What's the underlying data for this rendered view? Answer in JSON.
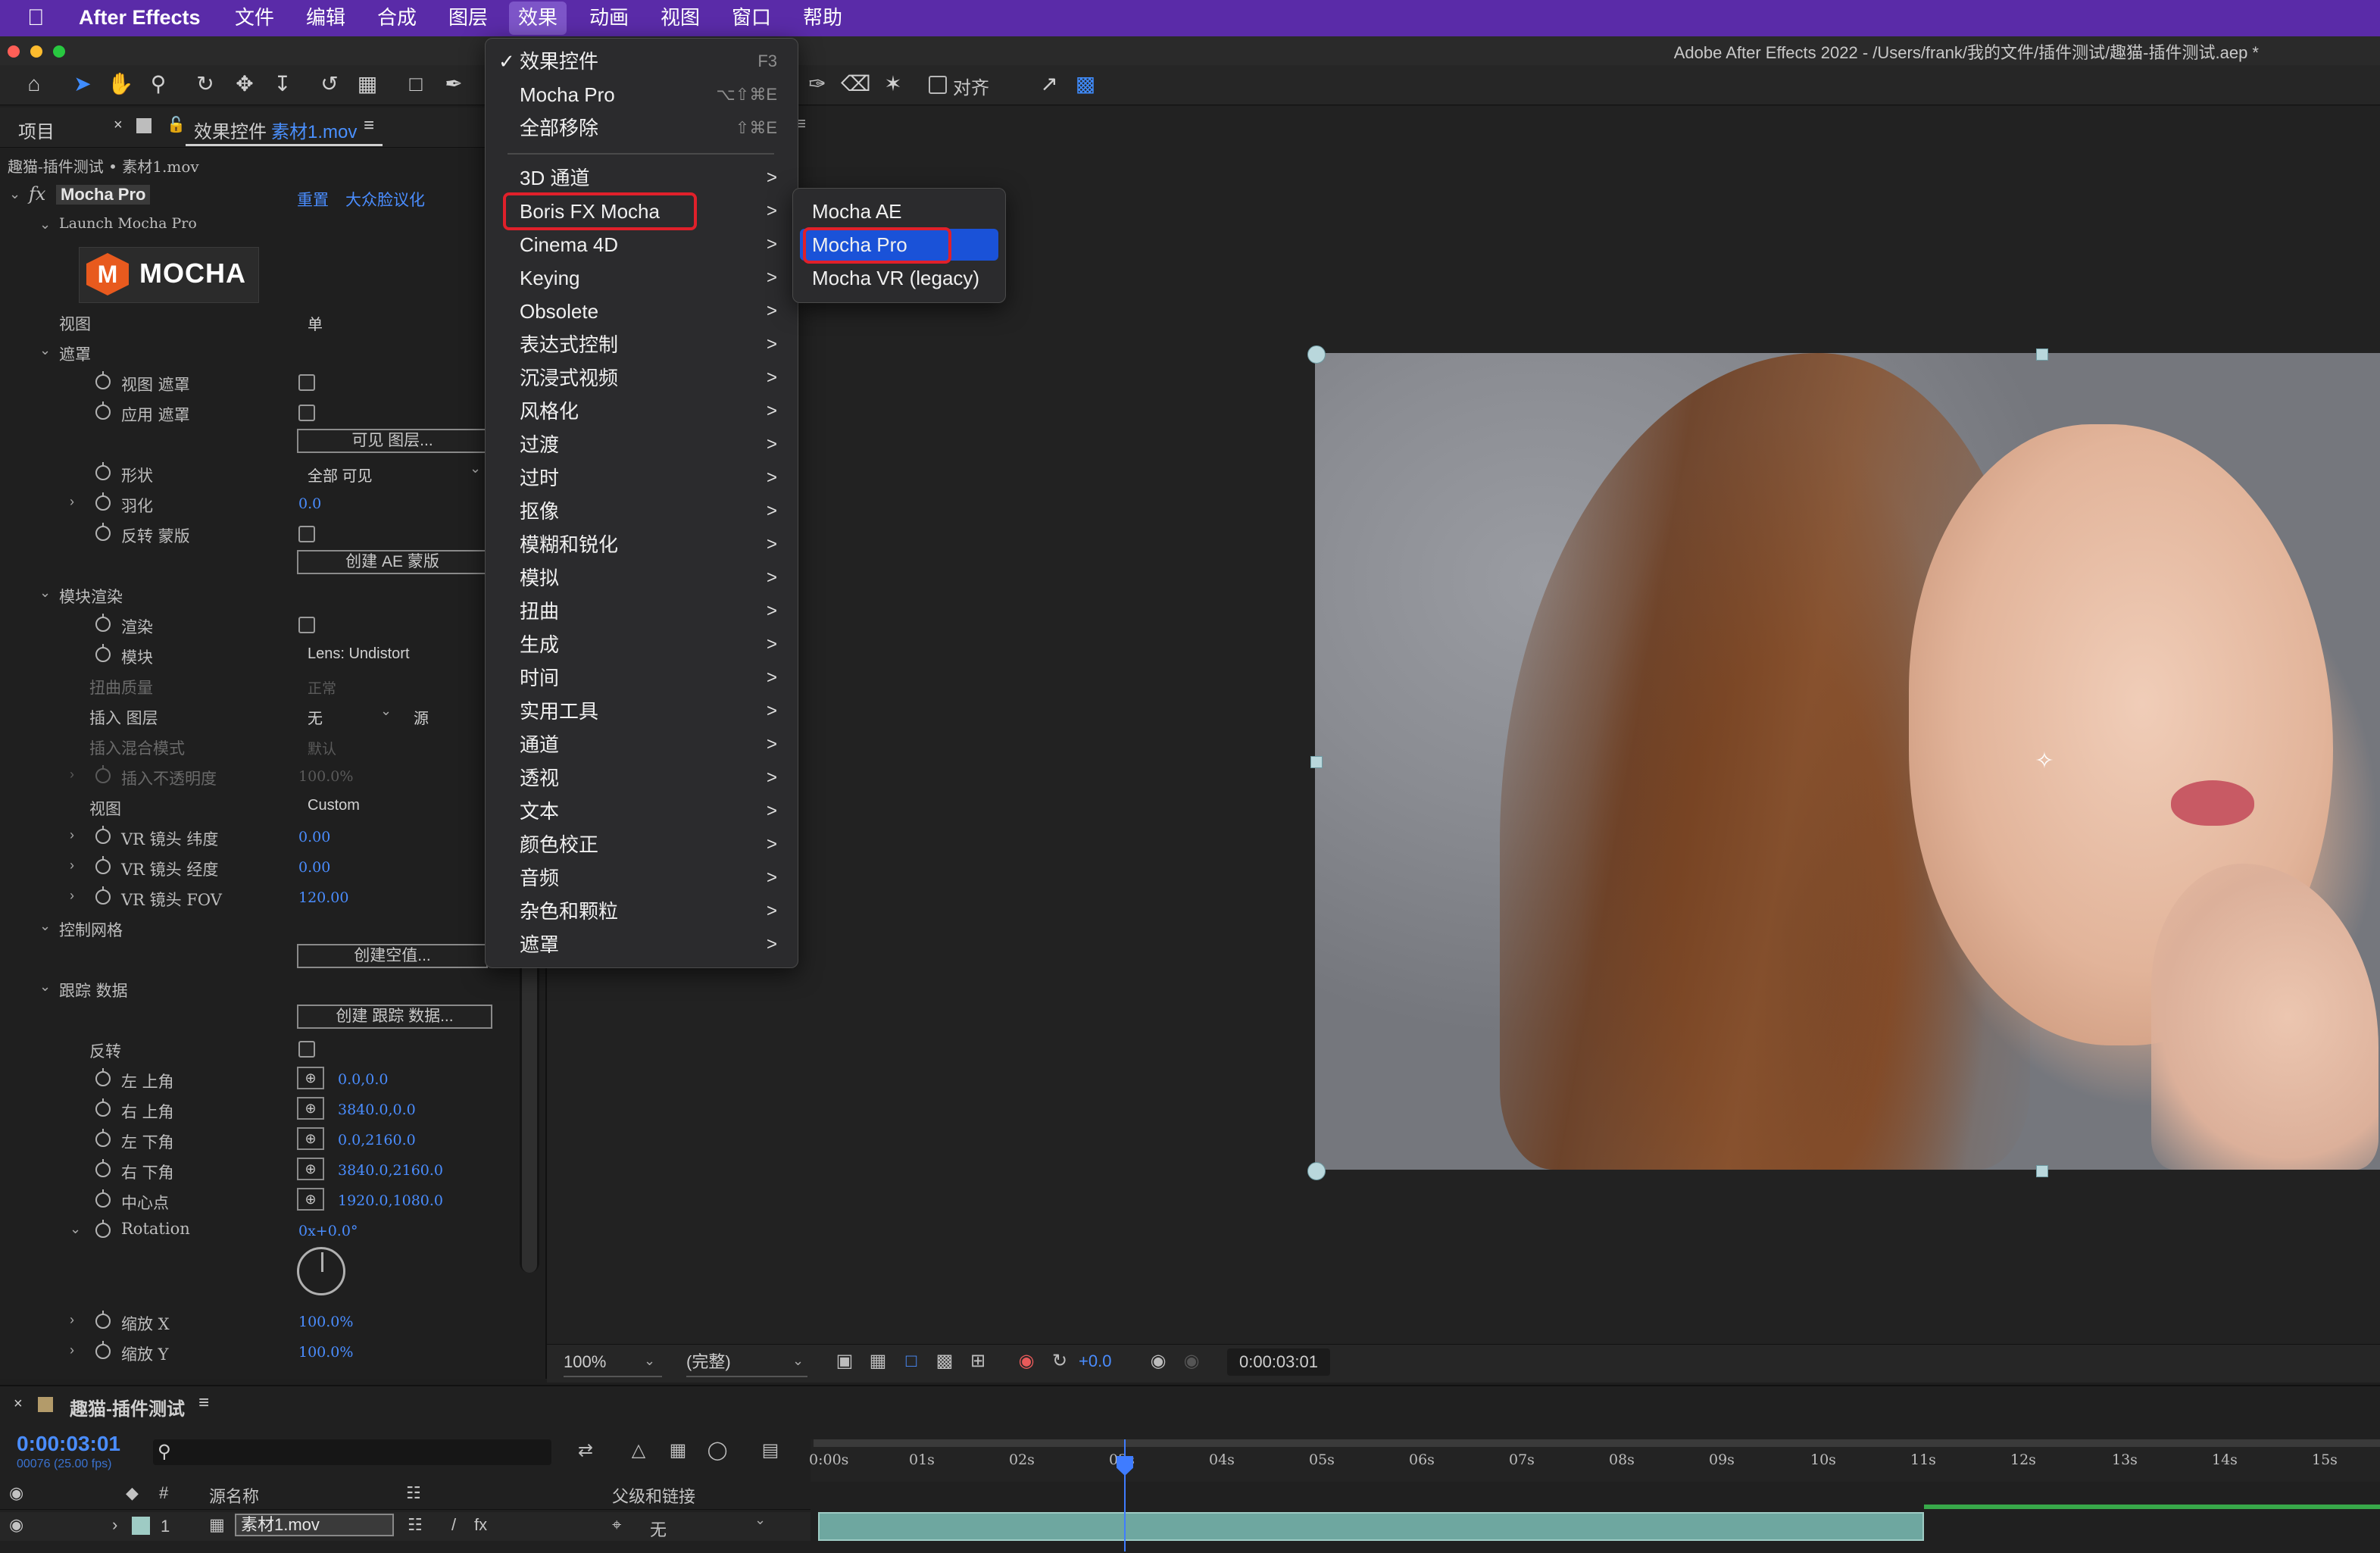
{
  "menubar": {
    "app_name": "After Effects",
    "items": [
      "文件",
      "编辑",
      "合成",
      "图层",
      "效果",
      "动画",
      "视图",
      "窗口",
      "帮助"
    ],
    "active_item": "效果"
  },
  "window": {
    "title": "Adobe After Effects 2022 - /Users/frank/我的文件/插件测试/趣猫-插件测试.aep *"
  },
  "toolbar": {
    "align_label": "对齐"
  },
  "left_panel": {
    "tab_project": "项目",
    "tab_effect_controls": "效果控件",
    "tab_effect_controls_source": "素材1.mov",
    "breadcrumb": "趣猫-插件测试 • 素材1.mov",
    "effect_name": "Mocha Pro",
    "reset_label": "重置",
    "preset_label": "大众脸议化",
    "launch_label": "Launch Mocha Pro",
    "logo_text": "MOCHA",
    "rows": {
      "view": {
        "label": "视图",
        "value": "单"
      },
      "matte_group": "遮罩",
      "view_matte": "视图 遮罩",
      "apply_matte": "应用 遮罩",
      "visible_layers_btn": "可见 图层...",
      "shape": {
        "label": "形状",
        "value": "全部 可见"
      },
      "feather": {
        "label": "羽化",
        "value": "0.0"
      },
      "invert_matte": "反转 蒙版",
      "create_ae_mask_btn": "创建 AE 蒙版",
      "module_render_group": "模块渲染",
      "render": "渲染",
      "module": {
        "label": "模块",
        "value": "Lens: Undistort"
      },
      "warp_quality": {
        "label": "扭曲质量",
        "value": "正常"
      },
      "insert_layer": {
        "label": "插入 图层",
        "value": "无",
        "source": "源"
      },
      "insert_blend": {
        "label": "插入混合模式",
        "value": "默认"
      },
      "insert_opacity": {
        "label": "插入不透明度",
        "value": "100.0%"
      },
      "view2": {
        "label": "视图",
        "value": "Custom"
      },
      "vr_lat": {
        "label": "VR 镜头 纬度",
        "value": "0.00"
      },
      "vr_lon": {
        "label": "VR 镜头 经度",
        "value": "0.00"
      },
      "vr_fov": {
        "label": "VR 镜头 FOV",
        "value": "120.00"
      },
      "control_grid_group": "控制网格",
      "create_null_btn": "创建空值...",
      "track_data_group": "跟踪 数据",
      "create_track_btn": "创建 跟踪 数据...",
      "invert": "反转",
      "top_left": {
        "label": "左 上角",
        "value": "0.0,0.0"
      },
      "top_right": {
        "label": "右 上角",
        "value": "3840.0,0.0"
      },
      "bottom_left": {
        "label": "左 下角",
        "value": "0.0,2160.0"
      },
      "bottom_right": {
        "label": "右 下角",
        "value": "3840.0,2160.0"
      },
      "center": {
        "label": "中心点",
        "value": "1920.0,1080.0"
      },
      "rotation": {
        "label": "Rotation",
        "value": "0x+0.0°"
      },
      "scale_x": {
        "label": "缩放 X",
        "value": "100.0%"
      },
      "scale_y": {
        "label": "缩放 Y",
        "value": "100.0%"
      }
    }
  },
  "effects_menu": {
    "items": [
      {
        "label": "效果控件",
        "shortcut": "F3",
        "checked": true
      },
      {
        "label": "Mocha Pro",
        "shortcut": "⌥⇧⌘E"
      },
      {
        "label": "全部移除",
        "shortcut": "⇧⌘E"
      },
      {
        "label": "3D 通道",
        "submenu": true
      },
      {
        "label": "Boris FX Mocha",
        "submenu": true,
        "highlighted": true
      },
      {
        "label": "Cinema 4D",
        "submenu": true
      },
      {
        "label": "Keying",
        "submenu": true
      },
      {
        "label": "Obsolete",
        "submenu": true
      },
      {
        "label": "表达式控制",
        "submenu": true
      },
      {
        "label": "沉浸式视频",
        "submenu": true
      },
      {
        "label": "风格化",
        "submenu": true
      },
      {
        "label": "过渡",
        "submenu": true
      },
      {
        "label": "过时",
        "submenu": true
      },
      {
        "label": "抠像",
        "submenu": true
      },
      {
        "label": "模糊和锐化",
        "submenu": true
      },
      {
        "label": "模拟",
        "submenu": true
      },
      {
        "label": "扭曲",
        "submenu": true
      },
      {
        "label": "生成",
        "submenu": true
      },
      {
        "label": "时间",
        "submenu": true
      },
      {
        "label": "实用工具",
        "submenu": true
      },
      {
        "label": "通道",
        "submenu": true
      },
      {
        "label": "透视",
        "submenu": true
      },
      {
        "label": "文本",
        "submenu": true
      },
      {
        "label": "颜色校正",
        "submenu": true
      },
      {
        "label": "音频",
        "submenu": true
      },
      {
        "label": "杂色和颗粒",
        "submenu": true
      },
      {
        "label": "遮罩",
        "submenu": true
      }
    ]
  },
  "submenu": {
    "items": [
      {
        "label": "Mocha AE"
      },
      {
        "label": "Mocha Pro",
        "selected": true
      },
      {
        "label": "Mocha VR (legacy)"
      }
    ]
  },
  "viewer_bar": {
    "zoom": "100%",
    "resolution": "(完整)",
    "exposure": "+0.0",
    "timecode": "0:00:03:01"
  },
  "timeline": {
    "comp_name": "趣猫-插件测试",
    "current_time": "0:00:03:01",
    "fps_info": "00076 (25.00 fps)",
    "col_source": "源名称",
    "col_parent": "父级和链接",
    "col_number": "#",
    "layer": {
      "index": "1",
      "name": "素材1.mov",
      "parent": "无"
    },
    "ruler": [
      "0:00s",
      "01s",
      "02s",
      "03s",
      "04s",
      "05s",
      "06s",
      "07s",
      "08s",
      "09s",
      "10s",
      "11s",
      "12s",
      "13s",
      "14s",
      "15s"
    ]
  },
  "colors": {
    "menubar": "#5a2ba8",
    "accent_blue": "#4a8dff",
    "highlight_red": "#e0202a",
    "menu_selection": "#1a52d8",
    "layer_bar": "#6ea7a0"
  }
}
